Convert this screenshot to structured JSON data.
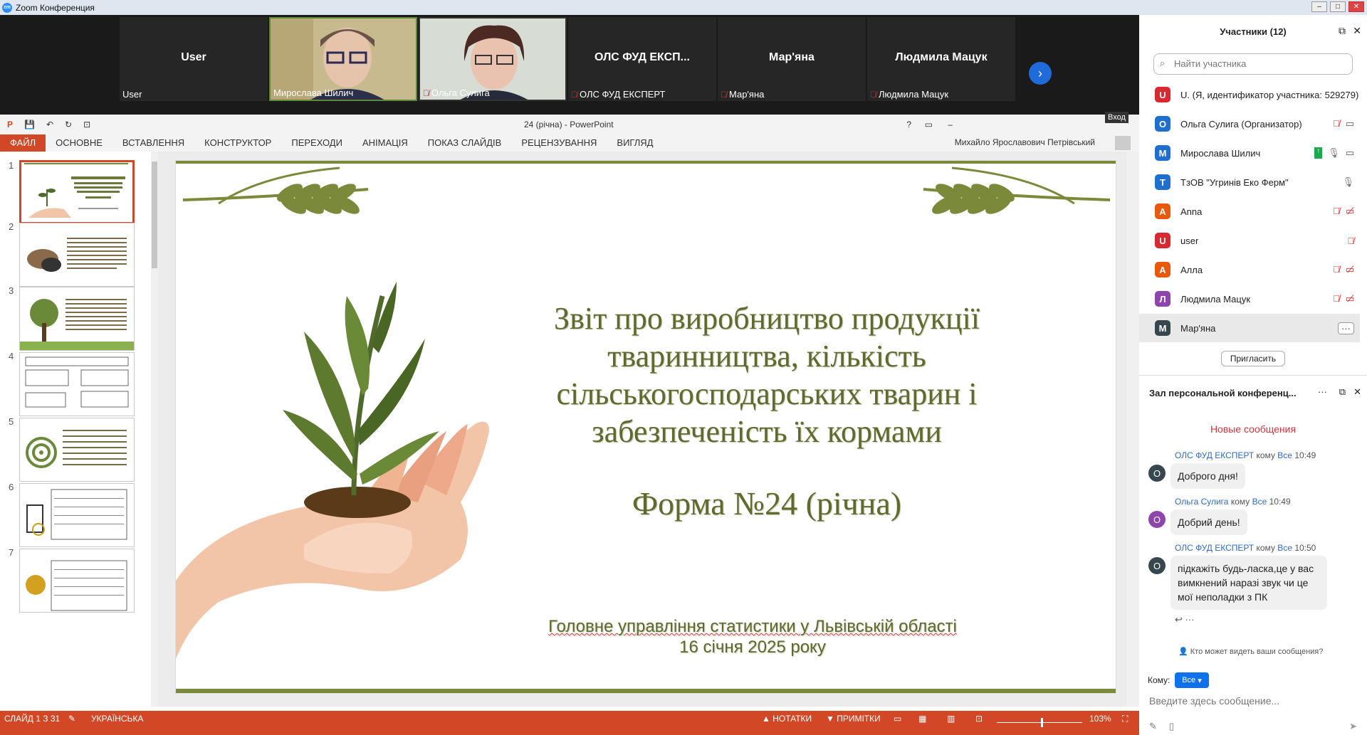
{
  "window": {
    "title": "Zoom Конференция"
  },
  "video_strip": {
    "tiles": [
      {
        "big": "User",
        "label": "User",
        "muted": false
      },
      {
        "big": "",
        "label": "Мирослава Шилич",
        "muted": false
      },
      {
        "big": "",
        "label": "Ольга Сулига",
        "muted": true
      },
      {
        "big": "ОЛС ФУД ЕКСП...",
        "label": "ОЛС ФУД ЕКСПЕРТ",
        "muted": true
      },
      {
        "big": "Мар'яна",
        "label": "Мар'яна",
        "muted": true
      },
      {
        "big": "Людмила Мацук",
        "label": "Людмила Мацук",
        "muted": true
      }
    ]
  },
  "ppt": {
    "doc_title": "24 (річна) - PowerPoint",
    "enter_label": "Вход",
    "tabs": [
      "ФАЙЛ",
      "ОСНОВНЕ",
      "ВСТАВЛЕННЯ",
      "КОНСТРУКТОР",
      "ПЕРЕХОДИ",
      "АНІМАЦІЯ",
      "ПОКАЗ СЛАЙДІВ",
      "РЕЦЕНЗУВАННЯ",
      "ВИГЛЯД"
    ],
    "user": "Михайло Ярославович Петрівський",
    "thumb_numbers": [
      "1",
      "2",
      "3",
      "4",
      "5",
      "6",
      "7"
    ],
    "slide": {
      "title": "Звіт про виробництво продукції тваринництва, кількість сільськогосподарських тварин і забезпеченість їх кормами",
      "form": "Форма №24 (річна)",
      "org": "Головне управління статистики у Львівській області",
      "date": "16 січня 2025 року"
    },
    "status": {
      "slide": "СЛАЙД 1 З 31",
      "language": "УКРАЇНСЬКА",
      "notes": "НОТАТКИ",
      "comments": "ПРИМІТКИ",
      "zoom": "103%"
    }
  },
  "participants": {
    "header": "Участники (12)",
    "search_placeholder": "Найти участника",
    "list": [
      {
        "initial": "U",
        "color": "#d9282f",
        "name": "U. (Я, идентификатор участника: 529279)"
      },
      {
        "initial": "О",
        "color": "#1f6fd1",
        "name": "Ольга Сулига (Организатор)"
      },
      {
        "initial": "М",
        "color": "#1f6fd1",
        "name": "Мирослава Шилич"
      },
      {
        "initial": "Т",
        "color": "#1f6fd1",
        "name": "ТзОВ \"Угринів Еко Ферм\""
      },
      {
        "initial": "А",
        "color": "#e8590c",
        "name": "Anna"
      },
      {
        "initial": "U",
        "color": "#d9282f",
        "name": "user"
      },
      {
        "initial": "А",
        "color": "#e8590c",
        "name": "Алла"
      },
      {
        "initial": "Л",
        "color": "#8e44ad",
        "name": "Людмила Мацук"
      },
      {
        "initial": "М",
        "color": "#37474f",
        "name": "Мар'яна"
      }
    ],
    "invite": "Пригласить"
  },
  "chat": {
    "title": "Зал персональной конференц...",
    "new_messages": "Новые сообщения",
    "messages": [
      {
        "initial": "О",
        "color": "#37474f",
        "sender": "ОЛС ФУД ЕКСПЕРТ",
        "to": "кому",
        "everyone": "Все",
        "time": "10:49",
        "text": "Доброго дня!"
      },
      {
        "initial": "О",
        "color": "#8e44ad",
        "sender": "Ольга Сулига",
        "to": "кому",
        "everyone": "Все",
        "time": "10:49",
        "text": "Добрий день!"
      },
      {
        "initial": "О",
        "color": "#37474f",
        "sender": "ОЛС ФУД ЕКСПЕРТ",
        "to": "кому",
        "everyone": "Все",
        "time": "10:50",
        "text": "підкажіть будь-ласка,це у вас вимкнений наразі звук чи це мої неполадки з ПК"
      }
    ],
    "who_sees": "Кто может видеть ваши сообщения?",
    "to_label": "Кому:",
    "to_value": "Все",
    "input_placeholder": "Введите здесь сообщение..."
  }
}
